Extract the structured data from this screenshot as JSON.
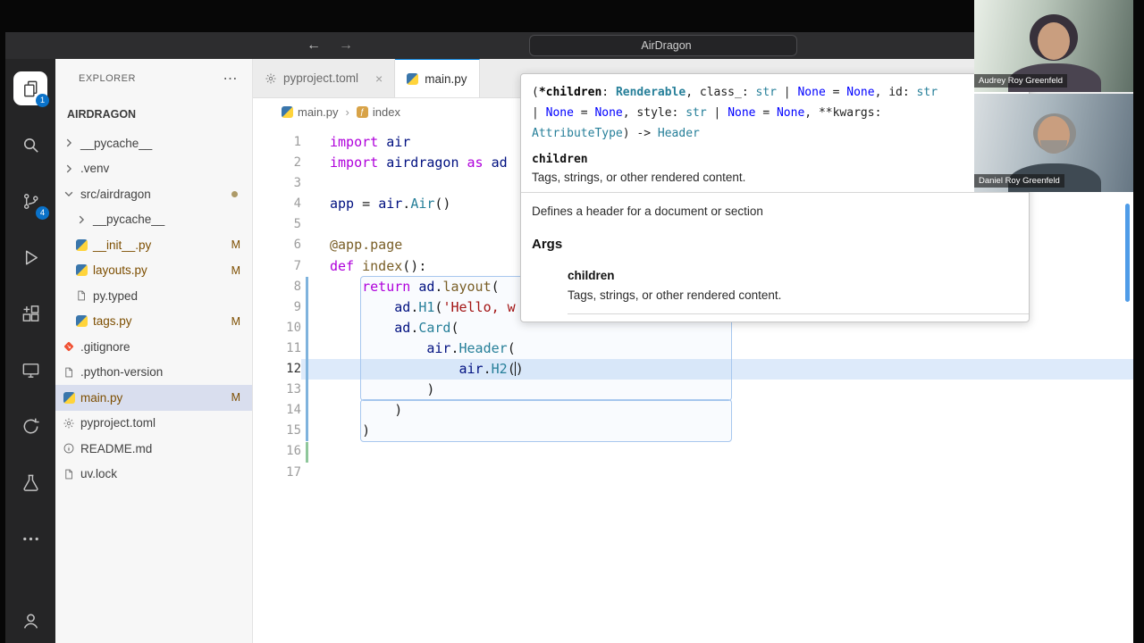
{
  "titlebar": {
    "back_glyph": "←",
    "forward_glyph": "→",
    "search_value": "AirDragon"
  },
  "webcams": [
    {
      "name": "Audrey Roy Greenfeld"
    },
    {
      "name": "Daniel Roy Greenfeld"
    }
  ],
  "activity_bar": {
    "items": [
      {
        "name": "explorer",
        "icon": "files",
        "badge": "1",
        "active": true
      },
      {
        "name": "search",
        "icon": "search"
      },
      {
        "name": "source-control",
        "icon": "source-control",
        "badge": "4"
      },
      {
        "name": "run-debug",
        "icon": "run"
      },
      {
        "name": "extensions",
        "icon": "extensions"
      },
      {
        "name": "remote-explorer",
        "icon": "monitor"
      },
      {
        "name": "sync",
        "icon": "sync"
      },
      {
        "name": "testing",
        "icon": "beaker"
      },
      {
        "name": "more-actions",
        "icon": "ellipsis"
      }
    ],
    "bottom": [
      {
        "name": "account",
        "icon": "account"
      }
    ]
  },
  "sidebar": {
    "title": "EXPLORER",
    "actions_glyph": "⋯",
    "section": "AIRDRAGON",
    "items": [
      {
        "label": "__pycache__",
        "kind": "folder",
        "depth": 0
      },
      {
        "label": ".venv",
        "kind": "folder",
        "depth": 0
      },
      {
        "label": "src/airdragon",
        "kind": "folder",
        "depth": 0,
        "expanded": true,
        "dot": true
      },
      {
        "label": "__pycache__",
        "kind": "folder",
        "depth": 1
      },
      {
        "label": "__init__.py",
        "icon": "python",
        "depth": 1,
        "badge": "M",
        "modified": true
      },
      {
        "label": "layouts.py",
        "icon": "python",
        "depth": 1,
        "badge": "M",
        "modified": true
      },
      {
        "label": "py.typed",
        "icon": "file",
        "depth": 1
      },
      {
        "label": "tags.py",
        "icon": "python",
        "depth": 1,
        "badge": "M",
        "modified": true
      },
      {
        "label": ".gitignore",
        "icon": "git",
        "depth": 0
      },
      {
        "label": ".python-version",
        "icon": "file",
        "depth": 0
      },
      {
        "label": "main.py",
        "icon": "python",
        "depth": 0,
        "badge": "M",
        "modified": true,
        "selected": true
      },
      {
        "label": "pyproject.toml",
        "icon": "gear",
        "depth": 0
      },
      {
        "label": "README.md",
        "icon": "info",
        "depth": 0
      },
      {
        "label": "uv.lock",
        "icon": "file",
        "depth": 0
      }
    ]
  },
  "editor": {
    "tabs": [
      {
        "label": "pyproject.toml",
        "icon": "gear",
        "close_label": "×"
      },
      {
        "label": "main.py",
        "icon": "python",
        "active": true
      }
    ],
    "breadcrumb": [
      {
        "label": "main.py",
        "icon": "python"
      },
      {
        "label": "index",
        "icon": "symbol-method"
      }
    ],
    "breadcrumb_sep": "›",
    "active_line": 12,
    "lines": [
      [
        [
          "kw",
          "import"
        ],
        [
          "pun",
          " "
        ],
        [
          "var",
          "air"
        ]
      ],
      [
        [
          "kw",
          "import"
        ],
        [
          "pun",
          " "
        ],
        [
          "var",
          "airdragon"
        ],
        [
          "kw",
          " as"
        ],
        [
          "var",
          " ad"
        ]
      ],
      [],
      [
        [
          "var",
          "app"
        ],
        [
          "pun",
          " = "
        ],
        [
          "var",
          "air"
        ],
        [
          "pun",
          "."
        ],
        [
          "cls",
          "Air"
        ],
        [
          "pun",
          "()"
        ]
      ],
      [],
      [
        [
          "dec",
          "@app.page"
        ]
      ],
      [
        [
          "kw",
          "def"
        ],
        [
          "pun",
          " "
        ],
        [
          "fn",
          "index"
        ],
        [
          "pun",
          "():"
        ]
      ],
      [
        [
          "ws",
          "    "
        ],
        [
          "kw",
          "return"
        ],
        [
          "pun",
          " "
        ],
        [
          "var",
          "ad"
        ],
        [
          "pun",
          "."
        ],
        [
          "fn",
          "layout"
        ],
        [
          "pun",
          "("
        ]
      ],
      [
        [
          "ws",
          "        "
        ],
        [
          "var",
          "ad"
        ],
        [
          "pun",
          "."
        ],
        [
          "cls",
          "H1"
        ],
        [
          "pun",
          "("
        ],
        [
          "str",
          "'Hello, w"
        ]
      ],
      [
        [
          "ws",
          "        "
        ],
        [
          "var",
          "ad"
        ],
        [
          "pun",
          "."
        ],
        [
          "cls",
          "Card"
        ],
        [
          "pun",
          "("
        ]
      ],
      [
        [
          "ws",
          "            "
        ],
        [
          "var",
          "air"
        ],
        [
          "pun",
          "."
        ],
        [
          "cls",
          "Header"
        ],
        [
          "pun",
          "("
        ]
      ],
      [
        [
          "ws",
          "                "
        ],
        [
          "var",
          "air"
        ],
        [
          "pun",
          "."
        ],
        [
          "cls",
          "H2"
        ],
        [
          "pun",
          "("
        ],
        [
          "cursor",
          ""
        ],
        [
          "pun",
          ")"
        ]
      ],
      [
        [
          "ws",
          "            "
        ],
        [
          "pun",
          ")"
        ]
      ],
      [
        [
          "ws",
          "        "
        ],
        [
          "pun",
          ")"
        ]
      ],
      [
        [
          "ws",
          "    "
        ],
        [
          "pun",
          ")"
        ]
      ],
      [],
      []
    ],
    "decorations": {
      "current_line": 12,
      "snippet_boxes": [
        {
          "from": 8,
          "to": 13
        },
        {
          "from": 14,
          "to": 15
        }
      ],
      "gutter_modified": {
        "from": 8,
        "to": 15
      },
      "gutter_added": {
        "from": 16,
        "to": 16
      }
    }
  },
  "hover": {
    "signature": [
      [
        [
          "sg-p",
          "("
        ],
        [
          "sg-b",
          "*children"
        ],
        [
          "sg-p",
          ": "
        ],
        [
          "sg-tb",
          "Renderable"
        ],
        [
          "sg-p",
          ", class_: "
        ],
        [
          "sg-t",
          "str"
        ],
        [
          "sg-p",
          " | "
        ],
        [
          "sg-n",
          "None"
        ],
        [
          "sg-p",
          " = "
        ],
        [
          "sg-n",
          "None"
        ],
        [
          "sg-p",
          ", id: "
        ],
        [
          "sg-t",
          "str"
        ]
      ],
      [
        [
          "sg-p",
          "| "
        ],
        [
          "sg-n",
          "None"
        ],
        [
          "sg-p",
          " = "
        ],
        [
          "sg-n",
          "None"
        ],
        [
          "sg-p",
          ", style: "
        ],
        [
          "sg-t",
          "str"
        ],
        [
          "sg-p",
          " | "
        ],
        [
          "sg-n",
          "None"
        ],
        [
          "sg-p",
          " = "
        ],
        [
          "sg-n",
          "None"
        ],
        [
          "sg-p",
          ", **kwargs:"
        ]
      ],
      [
        [
          "sg-t",
          "AttributeType"
        ],
        [
          "sg-p",
          ") -> "
        ],
        [
          "sg-t",
          "Header"
        ]
      ]
    ],
    "param_label": "children",
    "param_desc": "Tags, strings, or other rendered content.",
    "doc": "Defines a header for a document or section",
    "args_heading": "Args",
    "args": [
      {
        "name": "children",
        "desc": "Tags, strings, or other rendered content."
      }
    ]
  }
}
